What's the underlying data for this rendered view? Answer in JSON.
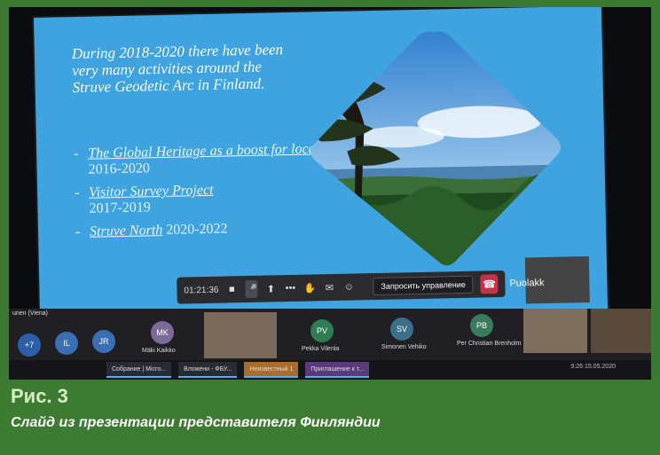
{
  "slide": {
    "intro": "During 2018-2020 there have been very many activities around the Struve Geodetic Arc in Finland.",
    "bullets": [
      {
        "link": "The Global Heritage as a boost for local services",
        "years": "2016-2020"
      },
      {
        "link": "Visitor Survey Project",
        "years": "2017-2019"
      },
      {
        "link": "Struve North",
        "years": "2020-2022"
      }
    ]
  },
  "toolbar": {
    "timer": "01:21:36",
    "request_control": "Запросить управление",
    "speaker_name": "Puolakk"
  },
  "participants": {
    "left_label": "unen (Viena)",
    "avatars": [
      {
        "initials": "+7",
        "color": "#2d5fa8"
      },
      {
        "initials": "IL",
        "color": "#3b6fb3"
      },
      {
        "initials": "JR",
        "color": "#3b6fb3"
      },
      {
        "initials": "MK",
        "color": "#7b6a9a",
        "name": "Mäki Kaikko"
      },
      {
        "initials": "PV",
        "color": "#2f7d55",
        "name": "Pekka Vilenla"
      },
      {
        "initials": "SV",
        "color": "#3b6f8a",
        "name": "Simonen Vehiko"
      },
      {
        "initials": "PB",
        "color": "#3b7a5a",
        "name": "Per Christian Brenholm"
      }
    ]
  },
  "taskbar": {
    "tasks": [
      {
        "label": "Собрание | Micro...",
        "style": "blue"
      },
      {
        "label": "Вложени - ФБУ...",
        "style": "blue"
      },
      {
        "label": "Неизвестный 1",
        "style": "orange"
      },
      {
        "label": "Приглашение к т...",
        "style": "purple"
      }
    ],
    "tray_time": "9:26",
    "tray_date": "15.05.2020"
  },
  "caption": {
    "title": "Рис. 3",
    "subtitle": "Слайд из презентации представителя Финляндии"
  }
}
